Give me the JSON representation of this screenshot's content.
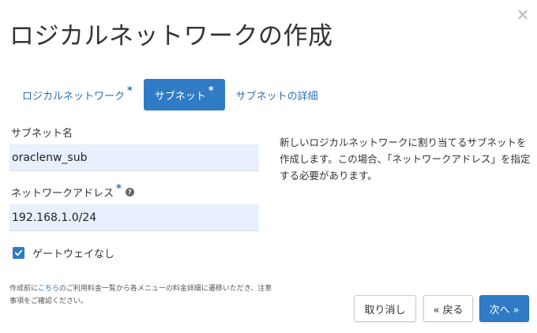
{
  "modal": {
    "title": "ロジカルネットワークの作成",
    "close_glyph": "×"
  },
  "tabs": [
    {
      "label": "ロジカルネットワーク",
      "required": "*",
      "active": false
    },
    {
      "label": "サブネット",
      "required": "*",
      "active": true
    },
    {
      "label": "サブネットの詳細",
      "required": "",
      "active": false
    }
  ],
  "form": {
    "subnet_name": {
      "label": "サブネット名",
      "value": "oraclenw_sub"
    },
    "network_address": {
      "label": "ネットワークアドレス",
      "required": "*",
      "help_glyph": "?",
      "value": "192.168.1.0/24"
    },
    "no_gateway": {
      "label": "ゲートウェイなし",
      "checked": true
    }
  },
  "description": "新しいロジカルネットワークに割り当てるサブネットを作成します。この場合、「ネットワークアドレス」を指定する必要があります。",
  "footnote": {
    "prefix": "作成前に",
    "link": "こちら",
    "suffix": "のご利用料金一覧から各メニューの料金詳細に遷移いただき、注意事項をご確認ください。"
  },
  "buttons": {
    "cancel": "取り消し",
    "back": "« 戻る",
    "next": "次へ »"
  },
  "colors": {
    "accent": "#2f7bc5",
    "link": "#2c6fb4",
    "input_bg": "#e8f0fe"
  }
}
